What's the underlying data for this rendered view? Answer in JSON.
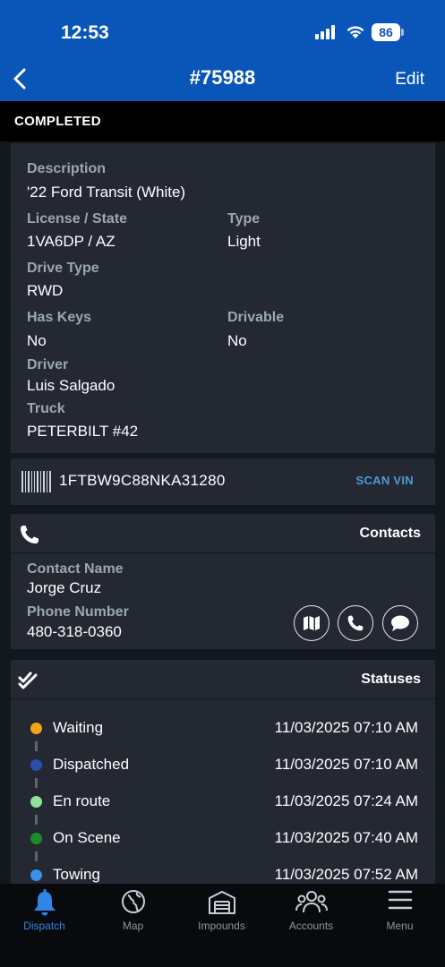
{
  "status_bar": {
    "time": "12:53",
    "battery": "86"
  },
  "nav": {
    "title": "#75988",
    "edit_label": "Edit"
  },
  "job_status": "COMPLETED",
  "vehicle": {
    "description_label": "Description",
    "description": "'22 Ford Transit (White)",
    "license_label": "License / State",
    "license": "1VA6DP / AZ",
    "type_label": "Type",
    "type": "Light",
    "drive_type_label": "Drive Type",
    "drive_type": "RWD",
    "has_keys_label": "Has Keys",
    "has_keys": "No",
    "drivable_label": "Drivable",
    "drivable": "No",
    "driver_label": "Driver",
    "driver": "Luis Salgado",
    "truck_label": "Truck",
    "truck": "PETERBILT #42"
  },
  "vin": {
    "value": "1FTBW9C88NKA31280",
    "scan_label": "SCAN VIN"
  },
  "contacts": {
    "title": "Contacts",
    "name_label": "Contact Name",
    "name": "Jorge Cruz",
    "phone_label": "Phone Number",
    "phone": "480-318-0360"
  },
  "statuses": {
    "title": "Statuses",
    "items": [
      {
        "name": "Waiting",
        "time": "11/03/2025 07:10 AM",
        "color": "#f5a31a"
      },
      {
        "name": "Dispatched",
        "time": "11/03/2025 07:10 AM",
        "color": "#2a4fa8"
      },
      {
        "name": "En route",
        "time": "11/03/2025 07:24 AM",
        "color": "#8fe39a"
      },
      {
        "name": "On Scene",
        "time": "11/03/2025 07:40 AM",
        "color": "#1e8a2c"
      },
      {
        "name": "Towing",
        "time": "11/03/2025 07:52 AM",
        "color": "#3d8fe8"
      }
    ]
  },
  "tabs": [
    {
      "label": "Dispatch",
      "icon": "bell-icon",
      "active": true
    },
    {
      "label": "Map",
      "icon": "globe-icon",
      "active": false
    },
    {
      "label": "Impounds",
      "icon": "garage-icon",
      "active": false
    },
    {
      "label": "Accounts",
      "icon": "people-icon",
      "active": false
    },
    {
      "label": "Menu",
      "icon": "hamburger-icon",
      "active": false
    }
  ],
  "colors": {
    "header_blue": "#0a56b8",
    "card_bg": "#232833",
    "label_gray": "#9aa7b5",
    "accent_link": "#4e9bd8",
    "active_tab": "#2e86e6"
  }
}
